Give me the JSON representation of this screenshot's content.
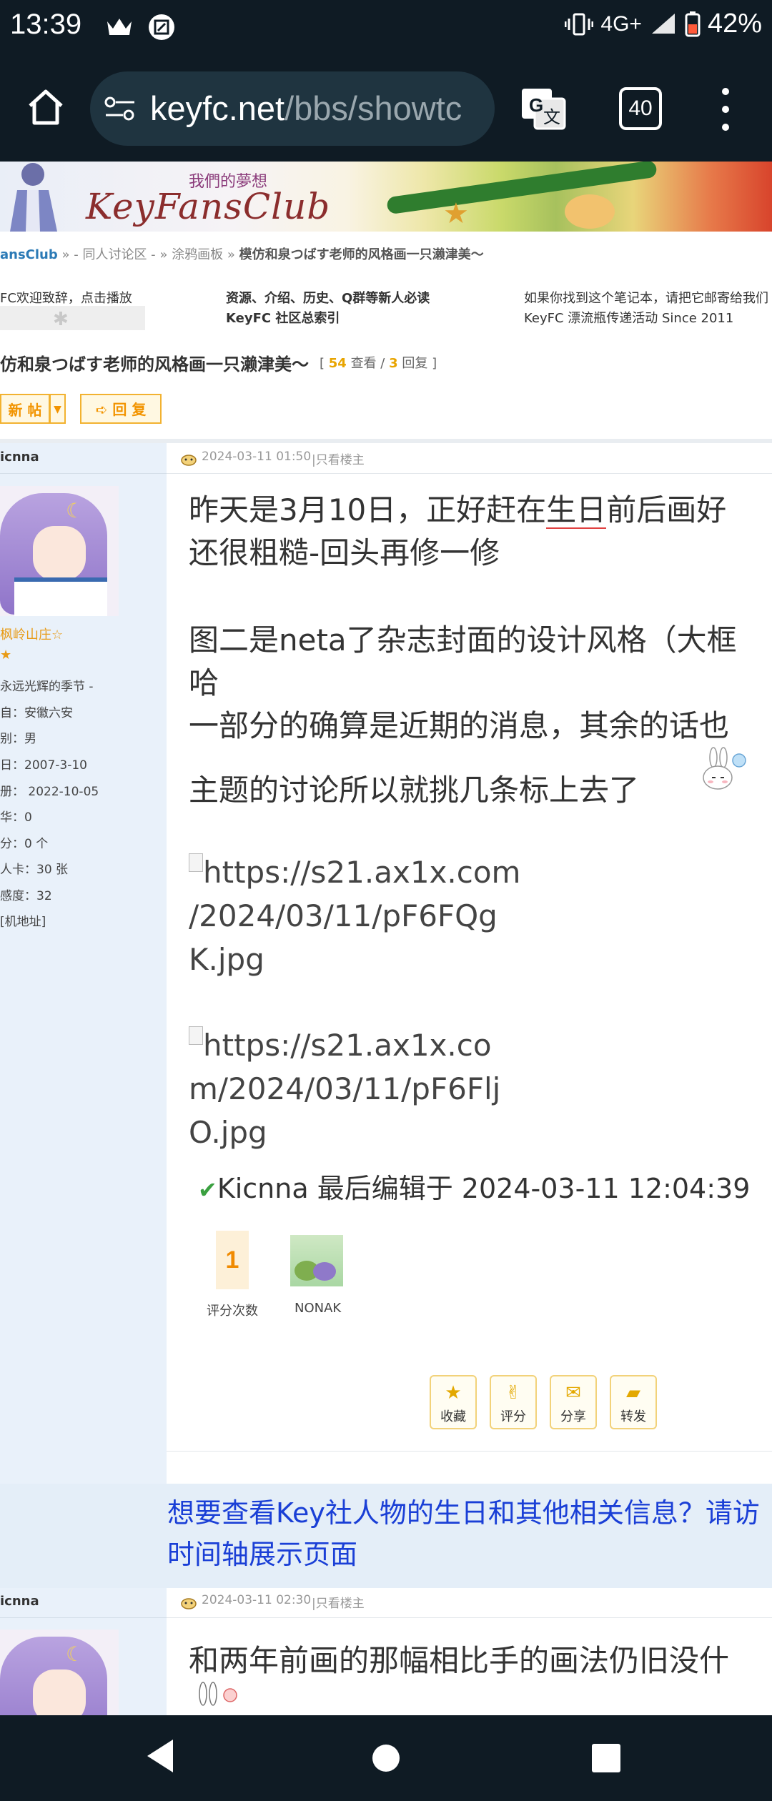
{
  "status_bar": {
    "time": "13:39",
    "network": "4G+",
    "battery": "42%",
    "icons": [
      "crown-icon",
      "screenshot-box-icon",
      "vibrate-icon",
      "signal-icon",
      "battery-icon"
    ]
  },
  "browser": {
    "url_host": "keyfc.net",
    "url_path": "/bbs/showtc",
    "tab_count": "40"
  },
  "banner": {
    "tagline": "我們的夢想",
    "logo": "KeyFansClub"
  },
  "breadcrumb": {
    "home": "ansClub",
    "sep1": " » ",
    "level1": "- 同人讨论区 -",
    "sep2": " » ",
    "level2": "涂鸦画板",
    "sep3": " » ",
    "current": "模仿和泉つばす老师的风格画一只濑津美〜"
  },
  "info_links": {
    "col1_line1": "FC欢迎致辞，点击播放",
    "col2_line1": "资源、介绍、历史、Q群等新人必读",
    "col2_line2": "KeyFC 社区总索引",
    "col3_line1": "如果你找到这个笔记本，请把它邮寄给我们",
    "col3_line2": "KeyFC 漂流瓶传递活动 Since 2011"
  },
  "thread": {
    "title": "仿和泉つばす老师的风格画一只濑津美〜",
    "views": "54",
    "views_label": "查看 /",
    "replies": "3",
    "replies_label": "回复",
    "open": "[",
    "close": "]",
    "new_post_label": "新 帖",
    "reply_label": "回 复"
  },
  "post1": {
    "author": "icnna",
    "nickname": "枫岭山庄☆",
    "details": [
      "永远光辉的季节 -",
      "自：安徽六安",
      "别：男",
      "日：2007-3-10",
      "册： 2022-10-05",
      "华：0",
      "分：0 个",
      "人卡：30 张",
      "感度：32",
      "[机地址]"
    ],
    "meta": "2024-03-11 01:50",
    "only_op": "|只看楼主",
    "line1_a": "昨天是3月10日，正好赶在",
    "line1_b": "生日",
    "line1_c": "前后画好",
    "line2": "还很粗糙-回头再修一修",
    "line3": "图二是neta了杂志封面的设计风格（大框",
    "line4": "哈",
    "line5": "一部分的确算是近期的消息，其余的话也",
    "line6": "主题的讨论所以就挑几条标上去了",
    "img1": [
      "https://s21.ax1x.com",
      "/2024/03/11/pF6FQg",
      "K.jpg"
    ],
    "img2": [
      "https://s21.ax1x.co",
      "m/2024/03/11/pF6Flj",
      "O.jpg"
    ],
    "edit_note": "Kicnna 最后编辑于 2024-03-11 12:04:39",
    "rate_count": "1",
    "rate_label": "评分次数",
    "rater_name": "NONAK",
    "actions": [
      "收藏",
      "评分",
      "分享",
      "转发"
    ]
  },
  "notice": {
    "line1": "想要查看Key社人物的生日和其他相关信息？请访",
    "line2": "时间轴展示页面"
  },
  "post2": {
    "author": "icnna",
    "meta": "2024-03-11 02:30",
    "only_op": "|只看楼主",
    "line1": "和两年前画的那幅相比手的画法仍旧没什"
  },
  "colors": {
    "accent_orange": "#f29400",
    "link_blue": "#1a3fd6",
    "side_bg": "#e9f1fa",
    "system_bar": "#0f1b24"
  }
}
